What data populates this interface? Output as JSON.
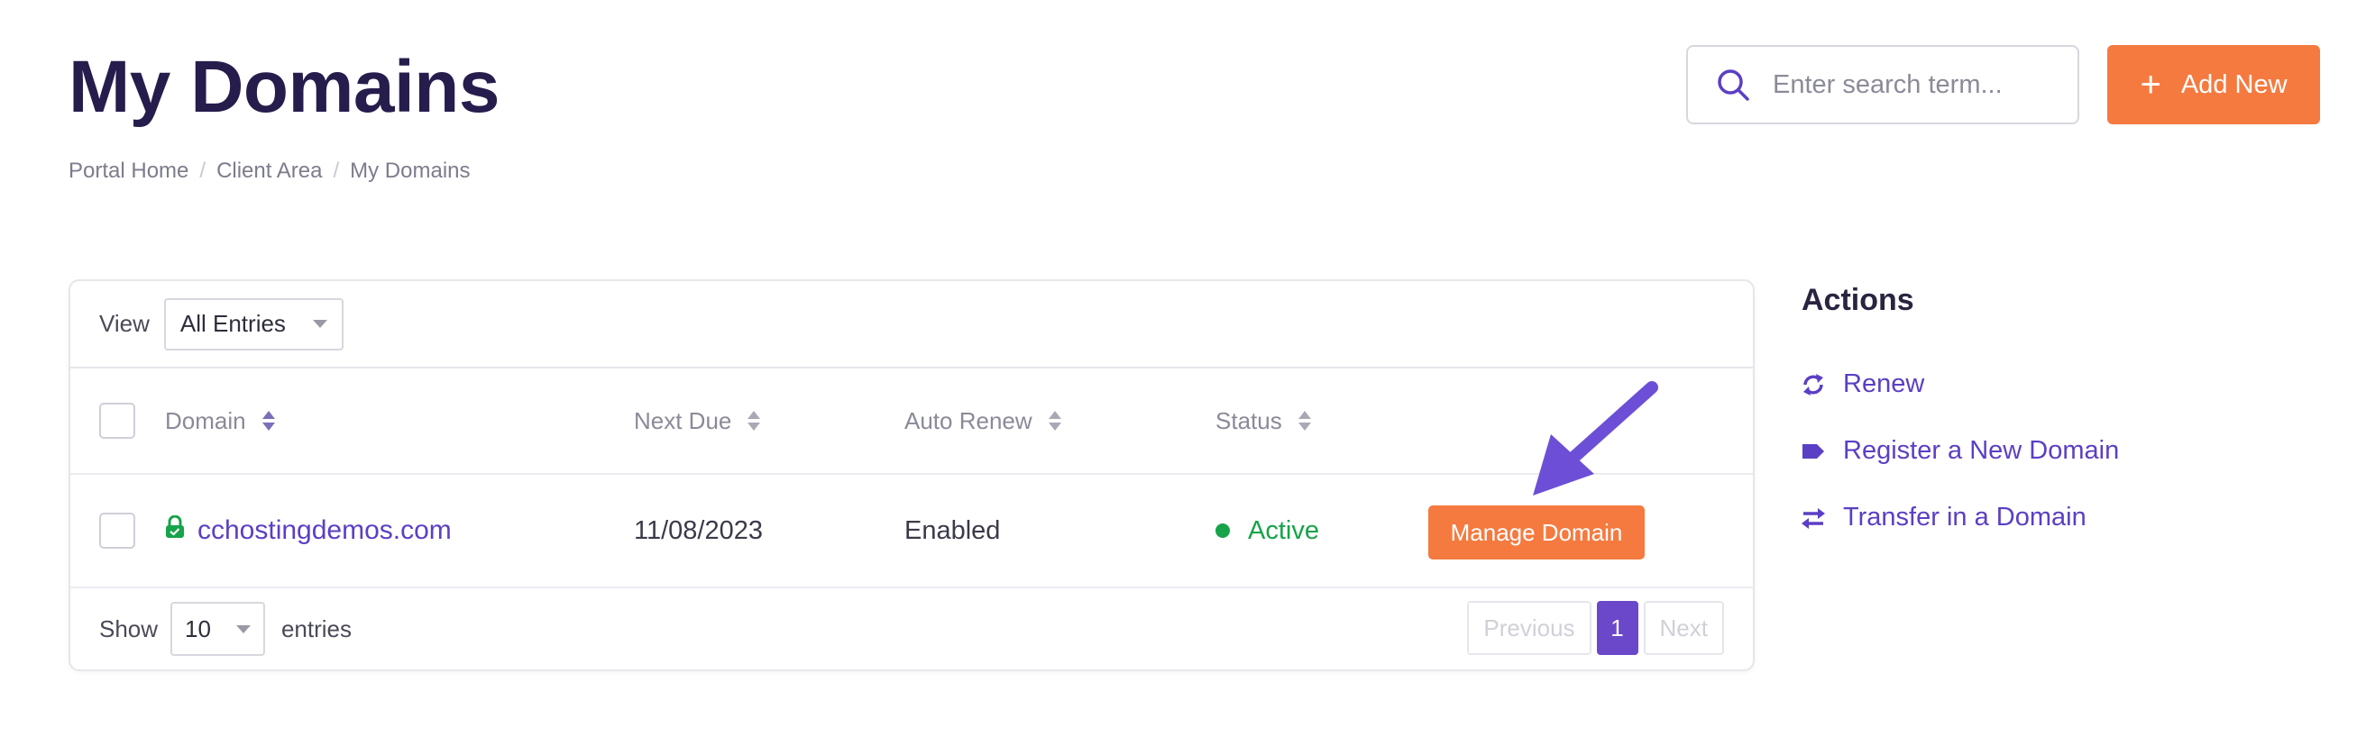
{
  "page": {
    "title": "My Domains",
    "breadcrumb": [
      "Portal Home",
      "Client Area",
      "My Domains"
    ]
  },
  "header": {
    "search_placeholder": "Enter search term...",
    "add_new_label": "Add New"
  },
  "table": {
    "view_label": "View",
    "view_selected": "All Entries",
    "columns": [
      "Domain",
      "Next Due",
      "Auto Renew",
      "Status"
    ],
    "rows": [
      {
        "domain": "cchostingdemos.com",
        "next_due": "11/08/2023",
        "auto_renew": "Enabled",
        "status": "Active",
        "action_label": "Manage Domain"
      }
    ],
    "show_label": "Show",
    "page_size": "10",
    "entries_label": "entries",
    "pagination": {
      "previous": "Previous",
      "current": "1",
      "next": "Next"
    }
  },
  "sidebar": {
    "title": "Actions",
    "items": [
      {
        "label": "Renew",
        "icon": "renew-icon"
      },
      {
        "label": "Register a New Domain",
        "icon": "tag-icon"
      },
      {
        "label": "Transfer in a Domain",
        "icon": "transfer-icon"
      }
    ]
  },
  "colors": {
    "accent": "#f57a3f",
    "link": "#5b3fc4",
    "title": "#261d4d",
    "status_active": "#17a34a",
    "pagination_active": "#6b48c9",
    "annotation_arrow": "#6c4fd6"
  }
}
